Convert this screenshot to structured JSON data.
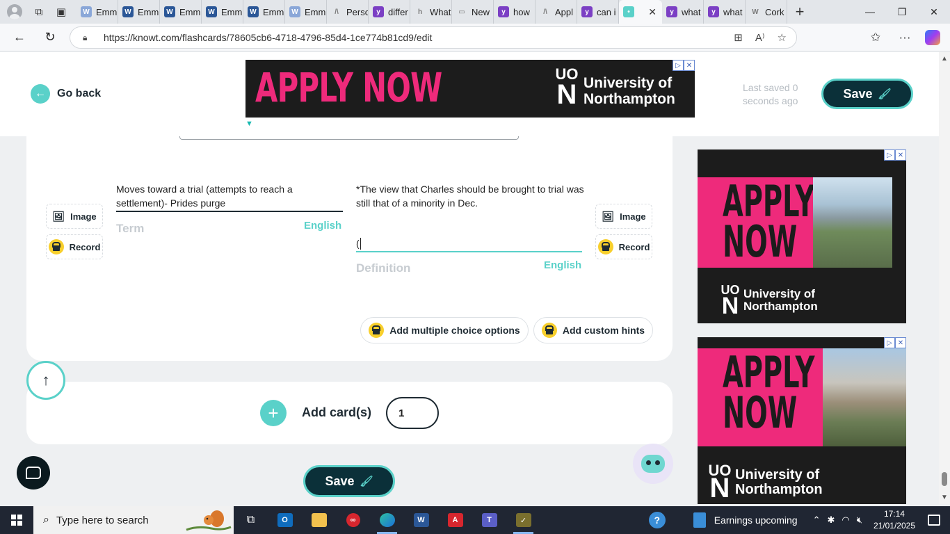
{
  "browser": {
    "tabs": [
      {
        "label": "Emm",
        "icon": "word-doc-icon",
        "color": "#8aa7d8",
        "glyph": "W"
      },
      {
        "label": "Emm",
        "icon": "word-icon",
        "color": "#2b5797",
        "glyph": "W"
      },
      {
        "label": "Emm",
        "icon": "word-icon",
        "color": "#2b5797",
        "glyph": "W"
      },
      {
        "label": "Emm",
        "icon": "word-icon",
        "color": "#2b5797",
        "glyph": "W"
      },
      {
        "label": "Emm",
        "icon": "word-icon",
        "color": "#2b5797",
        "glyph": "W"
      },
      {
        "label": "Emm",
        "icon": "word-doc-icon",
        "color": "#8aa7d8",
        "glyph": "W"
      },
      {
        "label": "Perso",
        "icon": "pdf-icon",
        "color": "#e3e6ea",
        "glyph": "/\\"
      },
      {
        "label": "differ",
        "icon": "yahoo-icon",
        "color": "#7b3fc4",
        "glyph": "y"
      },
      {
        "label": "What",
        "icon": "h-icon",
        "color": "#e3e6ea",
        "glyph": "h"
      },
      {
        "label": "New",
        "icon": "newtab-icon",
        "color": "#e3e6ea",
        "glyph": "▭"
      },
      {
        "label": "how",
        "icon": "yahoo-icon",
        "color": "#7b3fc4",
        "glyph": "y"
      },
      {
        "label": "Appl",
        "icon": "pdf-icon",
        "color": "#e3e6ea",
        "glyph": "/\\"
      },
      {
        "label": "can i",
        "icon": "yahoo-icon",
        "color": "#7b3fc4",
        "glyph": "y"
      },
      {
        "label": "",
        "icon": "knowt-icon",
        "color": "#5ad1c9",
        "glyph": "•",
        "active": true
      },
      {
        "label": "what",
        "icon": "yahoo-icon",
        "color": "#7b3fc4",
        "glyph": "y"
      },
      {
        "label": "what",
        "icon": "yahoo-icon",
        "color": "#7b3fc4",
        "glyph": "y"
      },
      {
        "label": "Cork",
        "icon": "wikipedia-icon",
        "color": "#e3e6ea",
        "glyph": "W"
      }
    ],
    "url": "https://knowt.com/flashcards/78605cb6-4718-4796-85d4-1ce774b81cd9/edit"
  },
  "header": {
    "go_back": "Go back",
    "last_saved": "Last saved 0 seconds ago",
    "save": "Save"
  },
  "ads": {
    "top": {
      "headline": "APPLY NOW",
      "mono_top": "UO",
      "mono_n": "N",
      "line1": "University of",
      "line2": "Northampton"
    },
    "side1": {
      "headline_1": "APPLY",
      "headline_2": "NOW",
      "mono_top": "UO",
      "mono_n": "N",
      "line1": "University of",
      "line2": "Northampton"
    },
    "side2": {
      "headline_1": "APPLY",
      "headline_2": "NOW",
      "mono_top": "UO",
      "mono_n": "N",
      "line1": "University of",
      "line2": "Northampton"
    }
  },
  "card": {
    "image_label": "Image",
    "record_label": "Record",
    "term_text": "Moves toward a trial (attempts to reach a settlement)- Prides purge",
    "term_label": "Term",
    "term_lang": "English",
    "definition_text": "*The view that Charles should be brought to trial was still that of a minority in Dec.",
    "definition_line2": "(",
    "definition_label": "Definition",
    "definition_lang": "English",
    "multiple_choice": "Add multiple choice options",
    "custom_hints": "Add custom hints"
  },
  "add_cards": {
    "label": "Add card(s)",
    "count": "1"
  },
  "footer": {
    "save": "Save"
  },
  "taskbar": {
    "search_placeholder": "Type here to search",
    "earnings": "Earnings upcoming",
    "time": "17:14",
    "date": "21/01/2025"
  },
  "colors": {
    "accent": "#5ad1c9",
    "dark": "#0b3039",
    "ad_pink": "#ee2a7b",
    "lock_yellow": "#f8cf2c"
  }
}
